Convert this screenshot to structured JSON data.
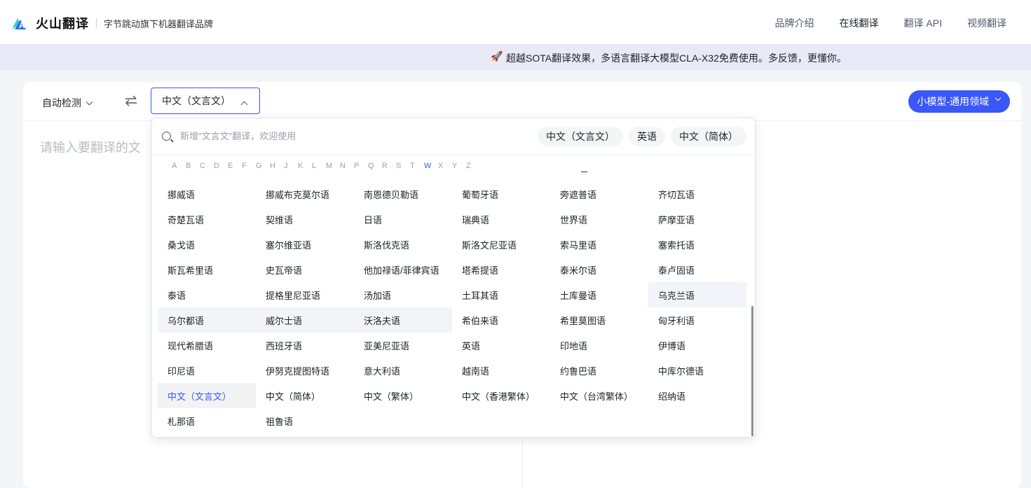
{
  "header": {
    "logo_text": "火山翻译",
    "tagline": "字节跳动旗下机器翻译品牌",
    "nav": [
      "品牌介绍",
      "在线翻译",
      "翻译 API",
      "视频翻译"
    ]
  },
  "banner": {
    "text": "超越SOTA翻译效果，多语言翻译大模型CLA-X32免费使用。多反馈，更懂你。"
  },
  "toolbar": {
    "source_lang": "自动检测",
    "target_lang": "中文（文言文）",
    "model_button": "小模型-通用领域"
  },
  "input": {
    "placeholder": "请输入要翻译的文"
  },
  "dropdown": {
    "search_placeholder": "新增\"文言文\"翻译，欢迎使用",
    "recent": [
      "中文（文言文）",
      "英语",
      "中文（简体）"
    ],
    "alphabet": [
      "A",
      "B",
      "C",
      "D",
      "E",
      "F",
      "G",
      "H",
      "J",
      "K",
      "L",
      "M",
      "N",
      "P",
      "Q",
      "R",
      "S",
      "T",
      "W",
      "X",
      "Y",
      "Z"
    ],
    "highlight_letter": "W",
    "languages": [
      "挪威语",
      "挪威布克莫尔语",
      "南恩德贝勒语",
      "葡萄牙语",
      "旁遮普语",
      "齐切瓦语",
      "奇楚瓦语",
      "契维语",
      "日语",
      "瑞典语",
      "世界语",
      "萨摩亚语",
      "桑戈语",
      "塞尔维亚语",
      "斯洛伐克语",
      "斯洛文尼亚语",
      "索马里语",
      "塞索托语",
      "斯瓦希里语",
      "史瓦帝语",
      "他加禄语/菲律宾语",
      "塔希提语",
      "泰米尔语",
      "泰卢固语",
      "泰语",
      "提格里尼亚语",
      "汤加语",
      "土耳其语",
      "土库曼语",
      "乌克兰语",
      "乌尔都语",
      "威尔士语",
      "沃洛夫语",
      "希伯来语",
      "希里莫图语",
      "匈牙利语",
      "现代希腊语",
      "西班牙语",
      "亚美尼亚语",
      "英语",
      "印地语",
      "伊博语",
      "印尼语",
      "伊努克提图特语",
      "意大利语",
      "越南语",
      "约鲁巴语",
      "中库尔德语",
      "中文（文言文）",
      "中文（简体）",
      "中文（繁体）",
      "中文（香港繁体）",
      "中文（台湾繁体）",
      "绍纳语",
      "札那语",
      "祖鲁语"
    ],
    "hover_items": [
      "乌克兰语",
      "乌尔都语",
      "威尔士语",
      "沃洛夫语"
    ],
    "selected_item": "中文（文言文）"
  },
  "colors": {
    "accent": "#3b57f5",
    "banner_bg": "#e8ebf7",
    "page_bg": "#f3f5f9"
  }
}
